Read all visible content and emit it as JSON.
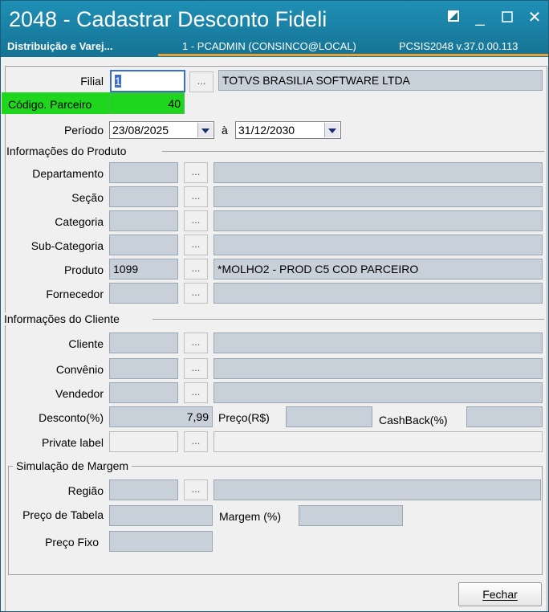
{
  "window": {
    "title": "2048 - Cadastrar Desconto Fideli",
    "subtitle_left": "Distribuição e Varej...",
    "subtitle_mid": "1 - PCADMIN (CONSINCO@LOCAL)",
    "subtitle_right": "PCSIS2048  v.37.0.00.113",
    "icons": {
      "restore": "restore-icon",
      "minimize": "minimize-icon",
      "maximize": "maximize-icon",
      "close": "close-icon"
    }
  },
  "header": {
    "filial_label": "Filial",
    "filial_value": "1",
    "filial_desc": "TOTVS BRASILIA SOFTWARE LTDA",
    "codigo_label": "Código. Parceiro",
    "codigo_value": "40",
    "periodo_label": "Período",
    "date_from": "23/08/2025",
    "a_label": "à",
    "date_to": "31/12/2030",
    "highlight_color": "#1ed61e"
  },
  "produto": {
    "section": "Informações do Produto",
    "departamento": "Departamento",
    "secao": "Seção",
    "categoria": "Categoria",
    "subcategoria": "Sub-Categoria",
    "produto": "Produto",
    "produto_code": "1099",
    "produto_desc": "*MOLHO2 - PROD C5 COD PARCEIRO",
    "fornecedor": "Fornecedor"
  },
  "cliente": {
    "section": "Informações do Cliente",
    "cliente": "Cliente",
    "convenio": "Convênio",
    "vendedor": "Vendedor",
    "desconto_label": "Desconto(%)",
    "desconto_value": "7,99",
    "preco_label": "Preço(R$)",
    "cashback_label": "CashBack(%)",
    "private_label": "Private label"
  },
  "simulacao": {
    "section": "Simulação de Margem",
    "regiao": "Região",
    "preco_tabela": "Preço de Tabela",
    "margem": "Margem (%)",
    "preco_fixo": "Preço Fixo"
  },
  "buttons": {
    "dots": "...",
    "fechar": "Fechar"
  }
}
